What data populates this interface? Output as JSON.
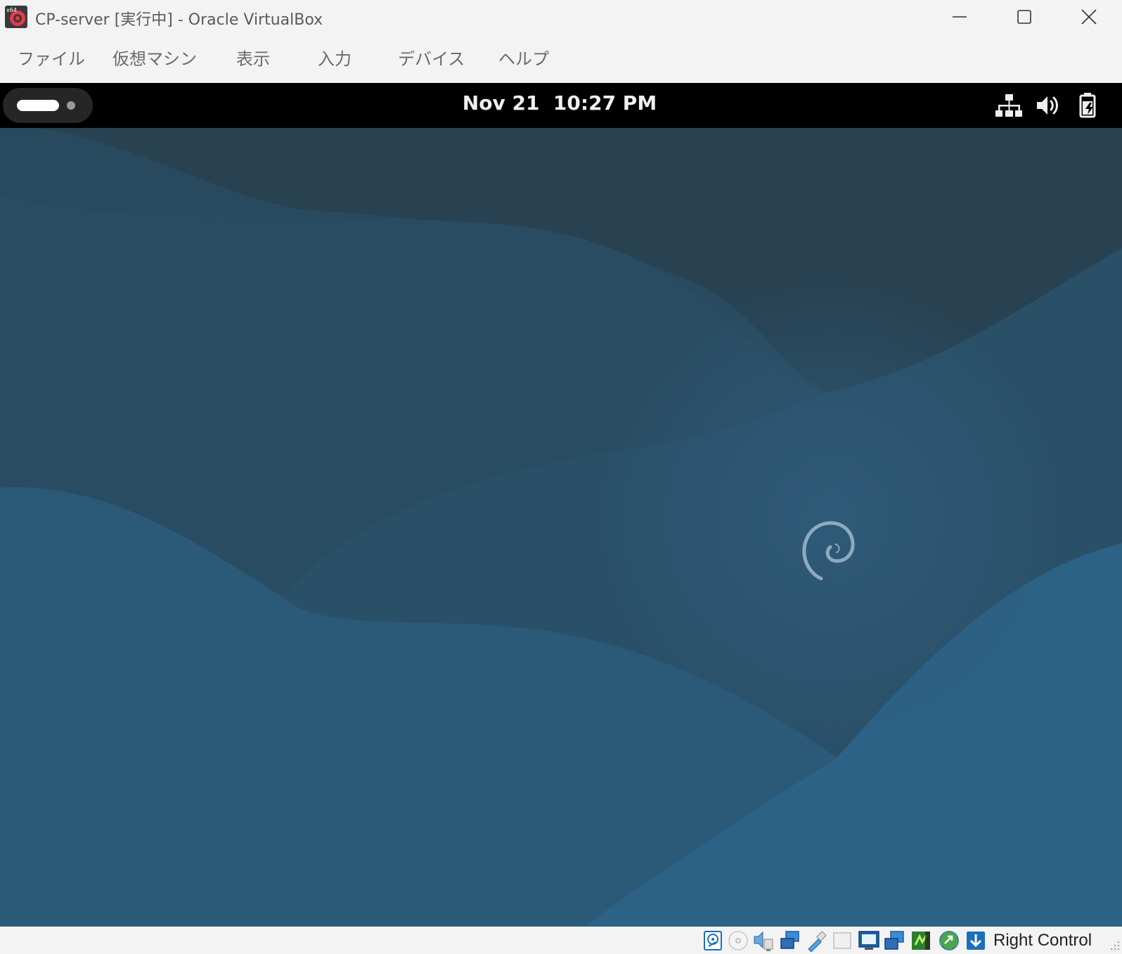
{
  "window": {
    "title": "CP-server [実行中] - Oracle VirtualBox",
    "app_icon_badge": "x64",
    "controls": [
      "minimize-icon",
      "maximize-icon",
      "close-icon"
    ]
  },
  "menubar": {
    "items": [
      "ファイル",
      "仮想マシン",
      "表示",
      "入力",
      "デバイス",
      "ヘルプ"
    ]
  },
  "guest": {
    "topbar": {
      "clock": "Nov 21  10:27 PM",
      "tray_icons": [
        "network-wired-icon",
        "volume-icon",
        "battery-charging-icon"
      ]
    },
    "wallpaper": {
      "logo": "debian-swirl-logo",
      "colors": {
        "dark": "#2a4456",
        "mid": "#2b5470",
        "light": "#2d6589"
      }
    }
  },
  "statusbar": {
    "icons": [
      "hard-disk-icon",
      "optical-drive-icon",
      "audio-icon",
      "network-icon",
      "usb-icon",
      "shared-folders-icon",
      "display-icon",
      "recording-icon",
      "cpu-icon",
      "mouse-integration-icon",
      "keyboard-capture-icon"
    ],
    "host_key": "Right Control"
  }
}
